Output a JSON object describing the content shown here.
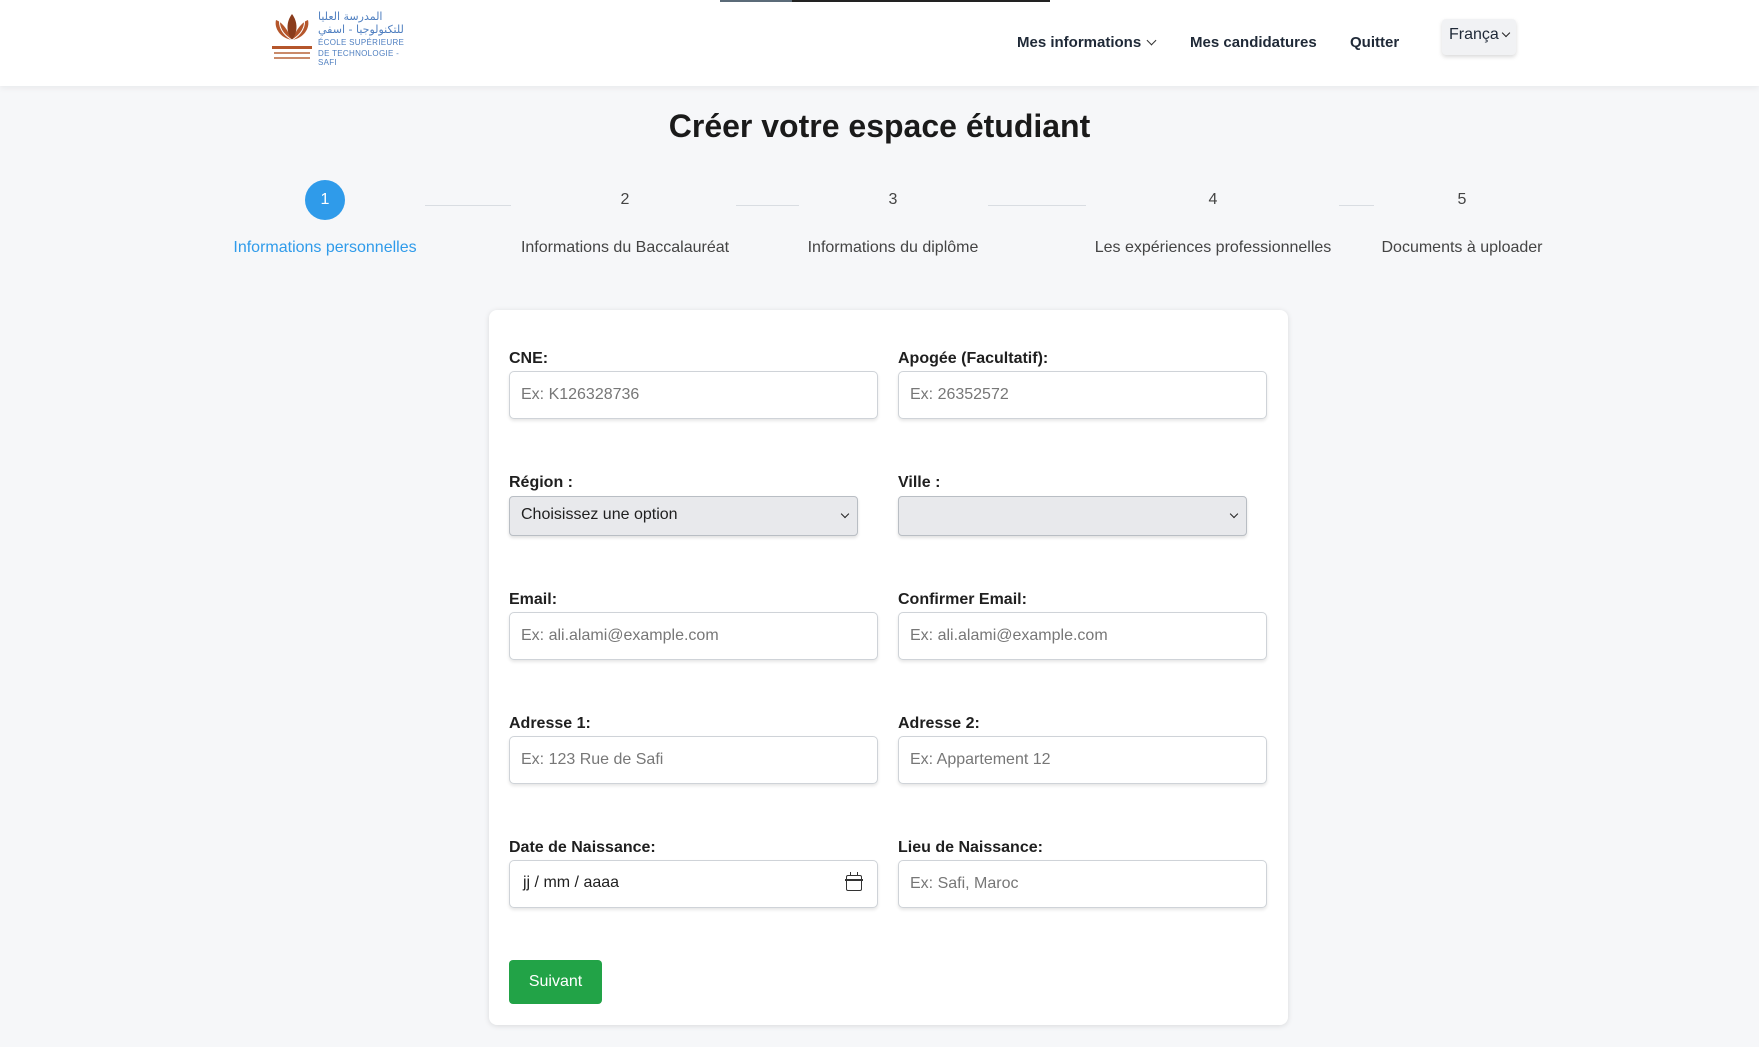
{
  "header": {
    "logo": {
      "arabic_line1": "المدرسة العليا",
      "arabic_line2": "للتكنولوجيا - اسفي",
      "french_line1": "ÉCOLE SUPÉRIEURE",
      "french_line2": "DE TECHNOLOGIE - SAFI",
      "brand_colors": [
        "#b5562b",
        "#4f7fc0"
      ]
    },
    "nav": {
      "mes_informations": "Mes informations",
      "mes_candidatures": "Mes candidatures",
      "quitter": "Quitter",
      "language": "França"
    }
  },
  "page_title": "Créer votre espace étudiant",
  "stepper": {
    "accent_color": "#2f9bea",
    "steps": [
      {
        "number": "1",
        "label": "Informations personnelles",
        "active": true
      },
      {
        "number": "2",
        "label": "Informations du Baccalauréat",
        "active": false
      },
      {
        "number": "3",
        "label": "Informations du diplôme",
        "active": false
      },
      {
        "number": "4",
        "label": "Les expériences professionnelles",
        "active": false
      },
      {
        "number": "5",
        "label": "Documents à uploader",
        "active": false
      }
    ]
  },
  "form": {
    "cne": {
      "label": "CNE:",
      "placeholder": "Ex: K126328736"
    },
    "apogee": {
      "label": "Apogée (Facultatif):",
      "placeholder": "Ex: 26352572"
    },
    "region": {
      "label": "Région :",
      "selected": "Choisissez une option"
    },
    "ville": {
      "label": "Ville :",
      "selected": ""
    },
    "email": {
      "label": "Email:",
      "placeholder": "Ex: ali.alami@example.com"
    },
    "confirm_email": {
      "label": "Confirmer Email:",
      "placeholder": "Ex: ali.alami@example.com"
    },
    "adresse1": {
      "label": "Adresse 1:",
      "placeholder": "Ex: 123 Rue de Safi"
    },
    "adresse2": {
      "label": "Adresse 2:",
      "placeholder": "Ex: Appartement 12"
    },
    "date_naissance": {
      "label": "Date de Naissance:",
      "value": "jj / mm / aaaa"
    },
    "lieu_naissance": {
      "label": "Lieu de Naissance:",
      "placeholder": "Ex: Safi, Maroc"
    },
    "submit": {
      "label": "Suivant",
      "color": "#22a347"
    }
  }
}
